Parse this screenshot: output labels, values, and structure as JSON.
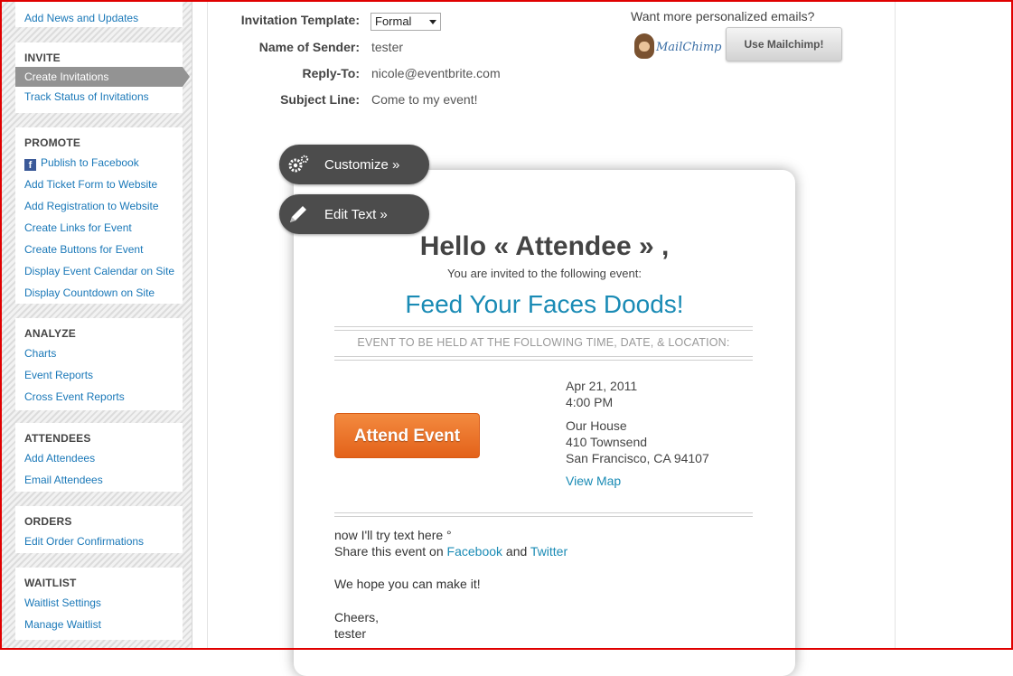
{
  "sidebar": {
    "top_link": "Add News and Updates",
    "sections": [
      {
        "title": "INVITE",
        "items": [
          "Create Invitations",
          "Track Status of Invitations"
        ]
      },
      {
        "title": "PROMOTE",
        "items": [
          "Publish to Facebook",
          "Add Ticket Form to Website",
          "Add Registration to Website",
          "Create Links for Event",
          "Create Buttons for Event",
          "Display Event Calendar on Site",
          "Display Countdown on Site"
        ]
      },
      {
        "title": "ANALYZE",
        "items": [
          "Charts",
          "Event Reports",
          "Cross Event Reports"
        ]
      },
      {
        "title": "ATTENDEES",
        "items": [
          "Add Attendees",
          "Email Attendees"
        ]
      },
      {
        "title": "ORDERS",
        "items": [
          "Edit Order Confirmations"
        ]
      },
      {
        "title": "WAITLIST",
        "items": [
          "Waitlist Settings",
          "Manage Waitlist"
        ]
      }
    ],
    "active_item": "Create Invitations"
  },
  "form": {
    "template_label": "Invitation Template:",
    "template_value": "Formal",
    "sender_label": "Name of Sender:",
    "sender_value": "tester",
    "reply_label": "Reply-To:",
    "reply_value": "nicole@eventbrite.com",
    "subject_label": "Subject Line:",
    "subject_value": "Come to my event!"
  },
  "mailchimp": {
    "prompt": "Want more personalized emails?",
    "logo_text": "MailChimp",
    "button": "Use Mailchimp!"
  },
  "tools": {
    "customize": "Customize »",
    "edit_text": "Edit Text »"
  },
  "email": {
    "greeting": "Hello « Attendee » ,",
    "invited": "You are invited to the following event:",
    "event_title": "Feed Your Faces Doods!",
    "held_header": "EVENT TO BE HELD AT THE FOLLOWING TIME, DATE, & LOCATION:",
    "attend_button": "Attend Event",
    "date": "Apr 21, 2011",
    "time": "4:00 PM",
    "venue": "Our House",
    "street": "410 Townsend",
    "city": "San Francisco, CA 94107",
    "view_map": "View Map",
    "custom_text": "now I'll try text here °",
    "share_prefix": "Share this event on",
    "share_facebook": "Facebook",
    "share_and": "and",
    "share_twitter": "Twitter",
    "hope": "We hope you can make it!",
    "cheers": "Cheers,",
    "signature": "tester"
  },
  "colors": {
    "link": "#1a78b8",
    "event_title": "#1a8bb5",
    "attend_button": "#e97a2c",
    "frame": "#e00000"
  }
}
